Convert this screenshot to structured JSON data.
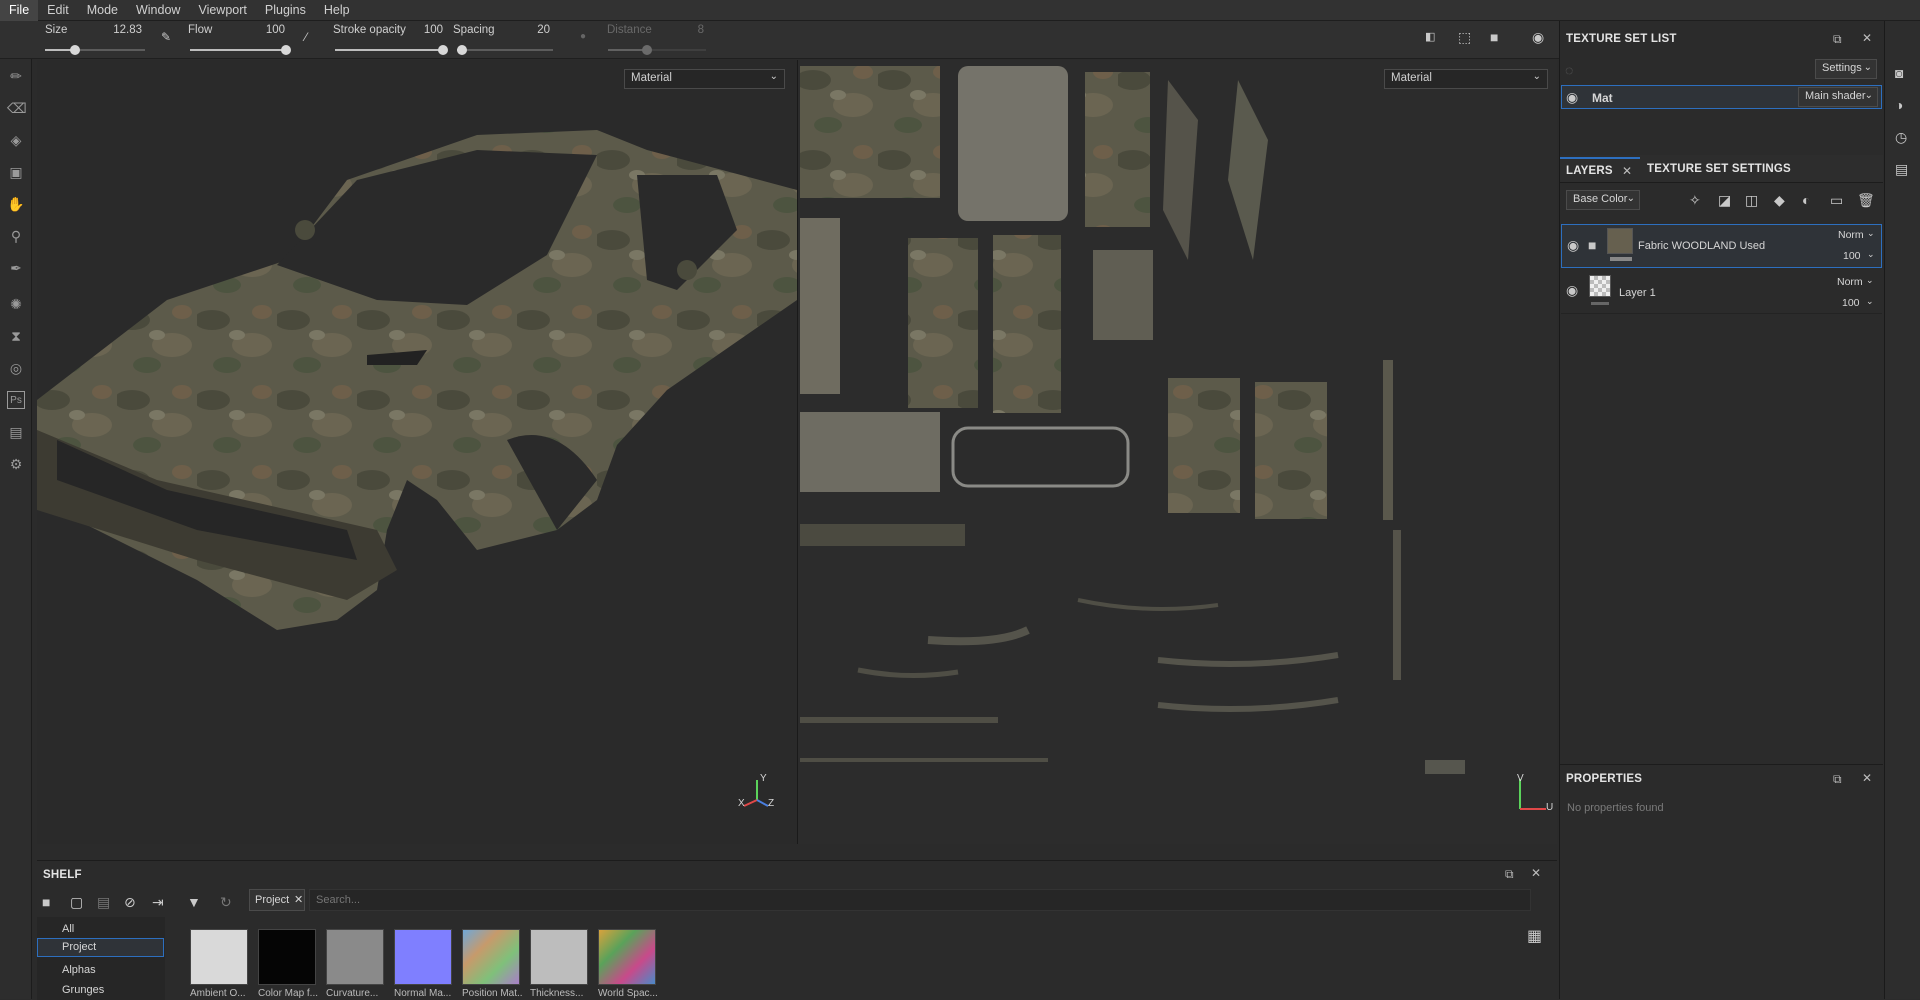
{
  "menu": [
    "File",
    "Edit",
    "Mode",
    "Window",
    "Viewport",
    "Plugins",
    "Help"
  ],
  "toolbar": {
    "size_label": "Size",
    "size_value": "12.83",
    "flow_label": "Flow",
    "flow_value": "100",
    "stroke_opacity_label": "Stroke opacity",
    "stroke_opacity_value": "100",
    "spacing_label": "Spacing",
    "spacing_value": "20",
    "distance_label": "Distance",
    "distance_value": "8",
    "size_level": 0.3,
    "flow_level": 1.0,
    "opacity_level": 1.0,
    "spacing_level": 0.05,
    "distance_level": 0.4
  },
  "viewport3d": {
    "mode_select": "Material"
  },
  "viewport2d": {
    "mode_select": "Material"
  },
  "axis_3d": {
    "x": "X",
    "y": "Y",
    "z": "Z"
  },
  "axis_2d": {
    "v": "V",
    "u": "U"
  },
  "texture_set_list": {
    "title": "TEXTURE SET LIST",
    "settings_button": "Settings",
    "item_name": "Mat",
    "shader_select": "Main shader"
  },
  "layers_panel": {
    "tab_layers": "LAYERS",
    "tab_settings": "TEXTURE SET SETTINGS",
    "channel_select": "Base Color",
    "layers": [
      {
        "name": "Fabric WOODLAND Used",
        "blend": "Norm",
        "opacity": "100"
      },
      {
        "name": "Layer 1",
        "blend": "Norm",
        "opacity": "100"
      }
    ]
  },
  "properties": {
    "title": "PROPERTIES",
    "empty_text": "No properties found"
  },
  "shelf": {
    "title": "SHELF",
    "filter_tag": "Project",
    "search_placeholder": "Search...",
    "categories": [
      "All",
      "Project",
      "Alphas",
      "Grunges"
    ],
    "items": [
      "Ambient O...",
      "Color Map f...",
      "Curvature...",
      "Normal Ma...",
      "Position Mat...",
      "Thickness...",
      "World Spac..."
    ]
  },
  "colors": {
    "accent": "#2d6fbf",
    "bg": "#2b2b2b",
    "normal_map": "#7f7fff"
  }
}
